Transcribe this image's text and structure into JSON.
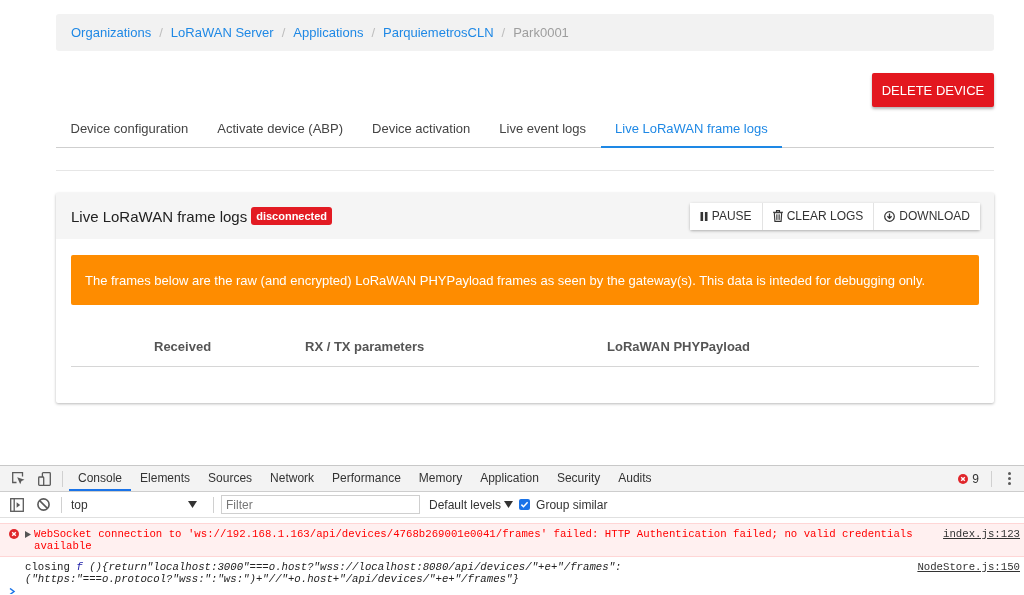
{
  "breadcrumb": {
    "items": [
      {
        "label": "Organizations",
        "current": false
      },
      {
        "label": "LoRaWAN Server",
        "current": false
      },
      {
        "label": "Applications",
        "current": false
      },
      {
        "label": "ParquiemetrosCLN",
        "current": false
      },
      {
        "label": "Park0001",
        "current": true
      }
    ],
    "separators": [
      "/",
      "/",
      "/",
      "/"
    ]
  },
  "delete_button": {
    "label": "DELETE DEVICE"
  },
  "tabs": [
    {
      "label": "Device configuration",
      "selected": false
    },
    {
      "label": "Activate device (ABP)",
      "selected": false
    },
    {
      "label": "Device activation",
      "selected": false
    },
    {
      "label": "Live event logs",
      "selected": false
    },
    {
      "label": "Live LoRaWAN frame logs",
      "selected": true
    }
  ],
  "card": {
    "title": "Live LoRaWAN frame logs",
    "status_badge": {
      "label": "disconnected",
      "connected": false
    },
    "buttons": [
      {
        "kind": "pause",
        "label": "PAUSE"
      },
      {
        "kind": "clear",
        "label": "CLEAR LOGS"
      },
      {
        "kind": "download",
        "label": "DOWNLOAD"
      }
    ],
    "alert": {
      "text": "The frames below are the raw (and encrypted) LoRaWAN PHYPayload frames as seen by the gateway(s). This data is inteded for debugging only."
    },
    "table": {
      "columns": [
        "Received",
        "RX / TX parameters",
        "LoRaWAN PHYPayload"
      ]
    }
  },
  "devtools": {
    "tabs": [
      {
        "label": "Console",
        "selected": true
      },
      {
        "label": "Elements",
        "selected": false
      },
      {
        "label": "Sources",
        "selected": false
      },
      {
        "label": "Network",
        "selected": false
      },
      {
        "label": "Performance",
        "selected": false
      },
      {
        "label": "Memory",
        "selected": false
      },
      {
        "label": "Application",
        "selected": false
      },
      {
        "label": "Security",
        "selected": false
      },
      {
        "label": "Audits",
        "selected": false
      }
    ],
    "error_count": "9",
    "context": {
      "value": "top"
    },
    "filter": {
      "placeholder": "Filter"
    },
    "levels": {
      "label": "Default levels"
    },
    "group_similar": {
      "label": "Group similar",
      "checked": true
    },
    "messages": [
      {
        "kind": "error",
        "text": "WebSocket connection to 'ws://192.168.1.163/api/devices/4768b269001e0041/frames' failed: HTTP Authentication failed; no valid credentials available",
        "source": "index.js:123"
      },
      {
        "kind": "log",
        "text": "closing",
        "function": {
          "prefix": "f",
          "lines": [
            "(){return\"localhost:3000\"===o.host?\"wss://localhost:8080/api/devices/\"+e+\"/frames\":",
            "(\"https:\"===o.protocol?\"wss:\":\"ws:\")+\"//\"+o.host+\"/api/devices/\"+e+\"/frames\"}"
          ]
        },
        "source": "NodeStore.js:150"
      }
    ]
  }
}
